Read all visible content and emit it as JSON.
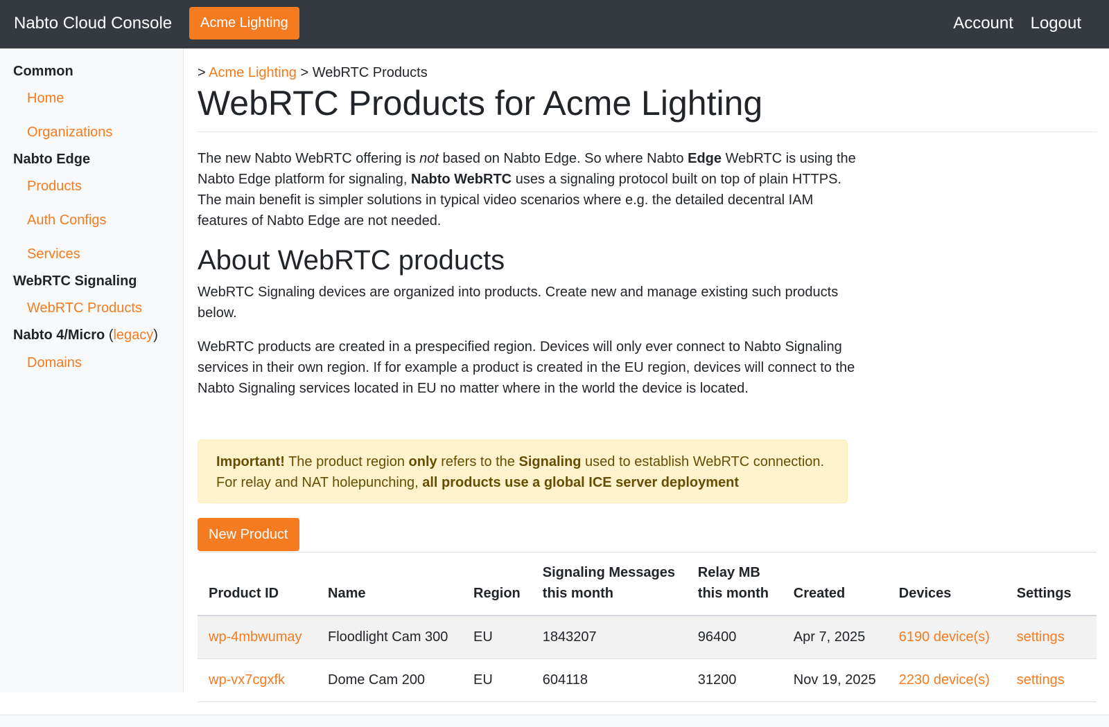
{
  "topbar": {
    "brand": "Nabto Cloud Console",
    "org_button": "Acme Lighting",
    "account": "Account",
    "logout": "Logout"
  },
  "sidebar": {
    "sections": [
      {
        "title": "Common",
        "items": [
          "Home",
          "Organizations"
        ]
      },
      {
        "title": "Nabto Edge",
        "items": [
          "Products",
          "Auth Configs",
          "Services"
        ]
      },
      {
        "title": "WebRTC Signaling",
        "items": [
          "WebRTC Products"
        ]
      },
      {
        "title": "Nabto 4/Micro",
        "legacy_link": "legacy",
        "items": [
          "Domains"
        ]
      }
    ]
  },
  "breadcrumb": {
    "prefix": ">",
    "org": "Acme Lighting",
    "sep": ">",
    "current": "WebRTC Products"
  },
  "page_title": "WebRTC Products for Acme Lighting",
  "intro": {
    "t1": "The new Nabto WebRTC offering is ",
    "em": "not",
    "t2": " based on Nabto Edge. So where Nabto ",
    "b1": "Edge",
    "t3": " WebRTC is using the Nabto Edge platform for signaling, ",
    "b2": "Nabto WebRTC",
    "t4": " uses a signaling protocol built on top of plain HTTPS. The main benefit is simpler solutions in typical video scenarios where e.g. the detailed decentral IAM features of Nabto Edge are not needed."
  },
  "about": {
    "title": "About WebRTC products",
    "p1": "WebRTC Signaling devices are organized into products. Create new and manage existing such products below.",
    "p2": "WebRTC products are created in a prespecified region. Devices will only ever connect to Nabto Signaling services in their own region. If for example a product is created in the EU region, devices will connect to the Nabto Signaling services located in EU no matter where in the world the device is located."
  },
  "alert": {
    "b1": "Important!",
    "t1": " The product region ",
    "b2": "only",
    "t2": " refers to the ",
    "b3": "Signaling",
    "t3": " used to establish WebRTC connection. For relay and NAT holepunching, ",
    "b4": "all products use a global ICE server deployment"
  },
  "new_product_label": "New Product",
  "table": {
    "headers": {
      "id": "Product ID",
      "name": "Name",
      "region": "Region",
      "sig1": "Signaling Messages",
      "sig2": "this month",
      "relay1": "Relay MB",
      "relay2": "this month",
      "created": "Created",
      "devices": "Devices",
      "settings": "Settings"
    },
    "rows": [
      {
        "id": "wp-4mbwumay",
        "name": "Floodlight Cam 300",
        "region": "EU",
        "sig": "1843207",
        "relay": "96400",
        "created": "Apr 7, 2025",
        "devices": "6190 device(s)",
        "settings": "settings"
      },
      {
        "id": "wp-vx7cgxfk",
        "name": "Dome Cam 200",
        "region": "EU",
        "sig": "604118",
        "relay": "31200",
        "created": "Nov 19, 2025",
        "devices": "2230 device(s)",
        "settings": "settings"
      }
    ]
  },
  "colors": {
    "accent": "#f47b20",
    "topbar": "#343a40",
    "alert_bg": "#fff3cd"
  }
}
